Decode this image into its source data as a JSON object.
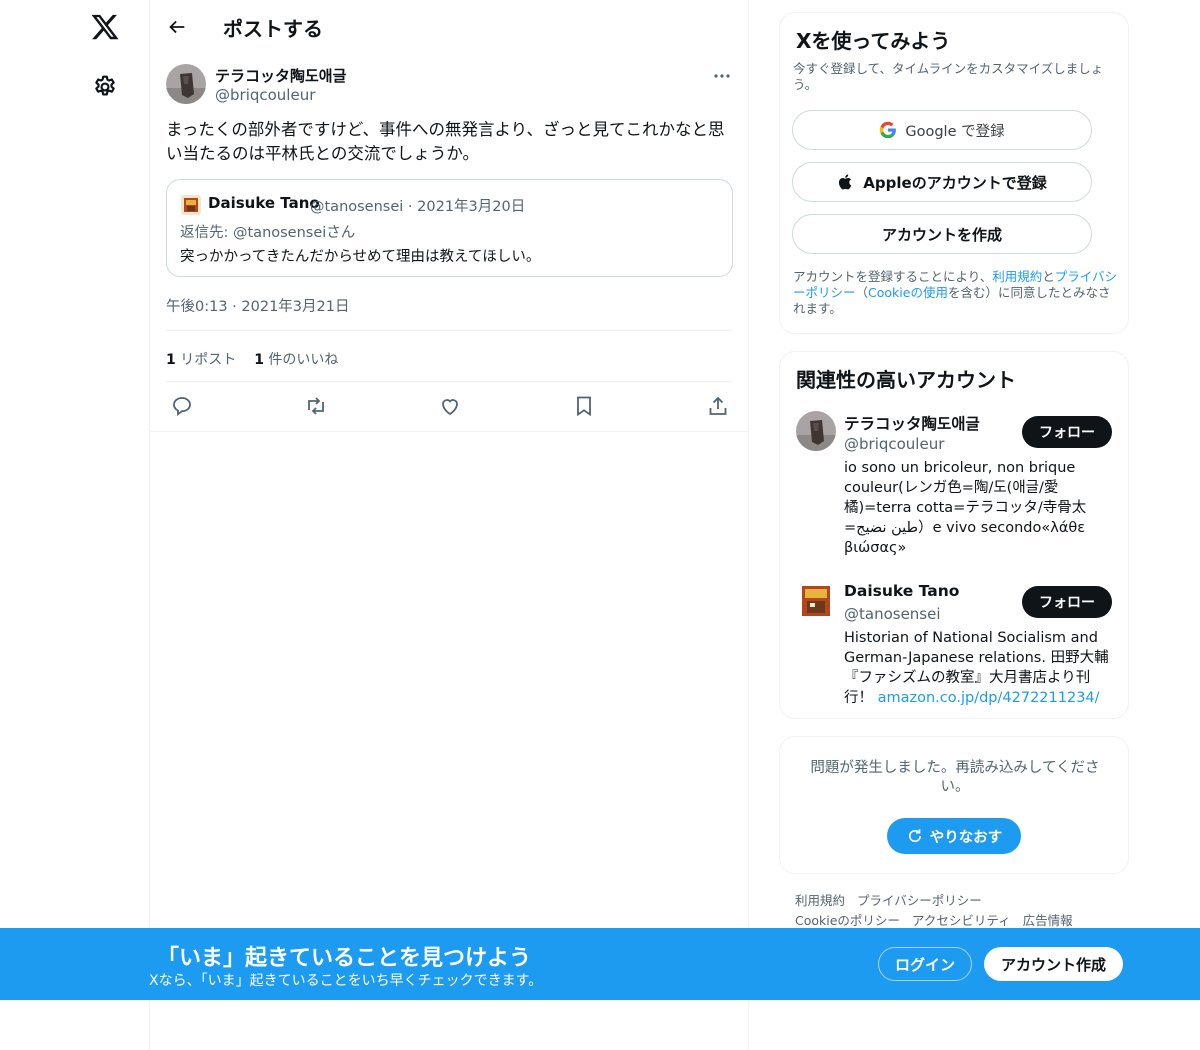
{
  "nav": {
    "logo_icon": "x-logo-icon",
    "settings_icon": "gear-icon"
  },
  "header": {
    "title": "ポストする"
  },
  "post": {
    "author_name": "テラコッタ陶도애글",
    "author_handle": "@briqcouleur",
    "text": "まったくの部外者ですけど、事件への無発言より、ざっと見てこれかなと思い当たるのは平林氏との交流でしょうか。",
    "quote": {
      "name": "Daisuke Tano",
      "handle": "@tanosensei",
      "date": "2021年3月20日",
      "reply_to": "返信先: @tanosenseiさん",
      "text": "突っかかってきたんだからせめて理由は教えてほしい。"
    },
    "timestamp": "午後0:13 · 2021年3月21日",
    "repost_count": "1",
    "repost_label": "リポスト",
    "like_count": "1",
    "like_label": "件のいいね"
  },
  "signup": {
    "title": "Xを使ってみよう",
    "subtitle": "今すぐ登録して、タイムラインをカスタマイズしましょう。",
    "google_label": "Google で登録",
    "apple_label": "Appleのアカウントで登録",
    "create_label": "アカウントを作成",
    "terms_1": "アカウントを登録することにより、",
    "terms_link_1": "利用規約",
    "terms_2": "と",
    "terms_link_2": "プライバシーポリシー",
    "terms_3": "（",
    "terms_link_3": "Cookieの使用",
    "terms_4": "を含む）に同意したとみなされます。"
  },
  "related": {
    "title": "関連性の高いアカウント",
    "accounts": [
      {
        "name": "テラコッタ陶도애글",
        "handle": "@briqcouleur",
        "bio": "io sono un bricoleur, non brique couleur(レンガ色=陶/도(애글/愛橘)=terra cotta=テラコッタ/寺骨太=طين نضيج）e vivo secondo«λάθε βιώσας»",
        "follow": "フォロー"
      },
      {
        "name": "Daisuke Tano",
        "handle": "@tanosensei",
        "bio": "Historian of National Socialism and German-Japanese relations. 田野大輔『ファシズムの教室』大月書店より刊行！ ",
        "bio_link": "amazon.co.jp/dp/4272211234/",
        "follow": "フォロー"
      }
    ]
  },
  "error": {
    "message": "問題が発生しました。再読み込みしてください。",
    "retry": "やりなおす"
  },
  "footer": {
    "links_row1": [
      "利用規約",
      "プライバシーポリシー"
    ],
    "links_row2": [
      "Cookieのポリシー",
      "アクセシビリティ",
      "広告情報"
    ]
  },
  "banner": {
    "title": "「いま」起きていることを見つけよう",
    "subtitle": "Xなら、「いま」起きていることをいち早くチェックできます。",
    "login": "ログイン",
    "create": "アカウント作成"
  },
  "colors": {
    "accent": "#1d9bf0",
    "text": "#0f1419",
    "muted": "#536471",
    "border": "#eff3f4"
  }
}
